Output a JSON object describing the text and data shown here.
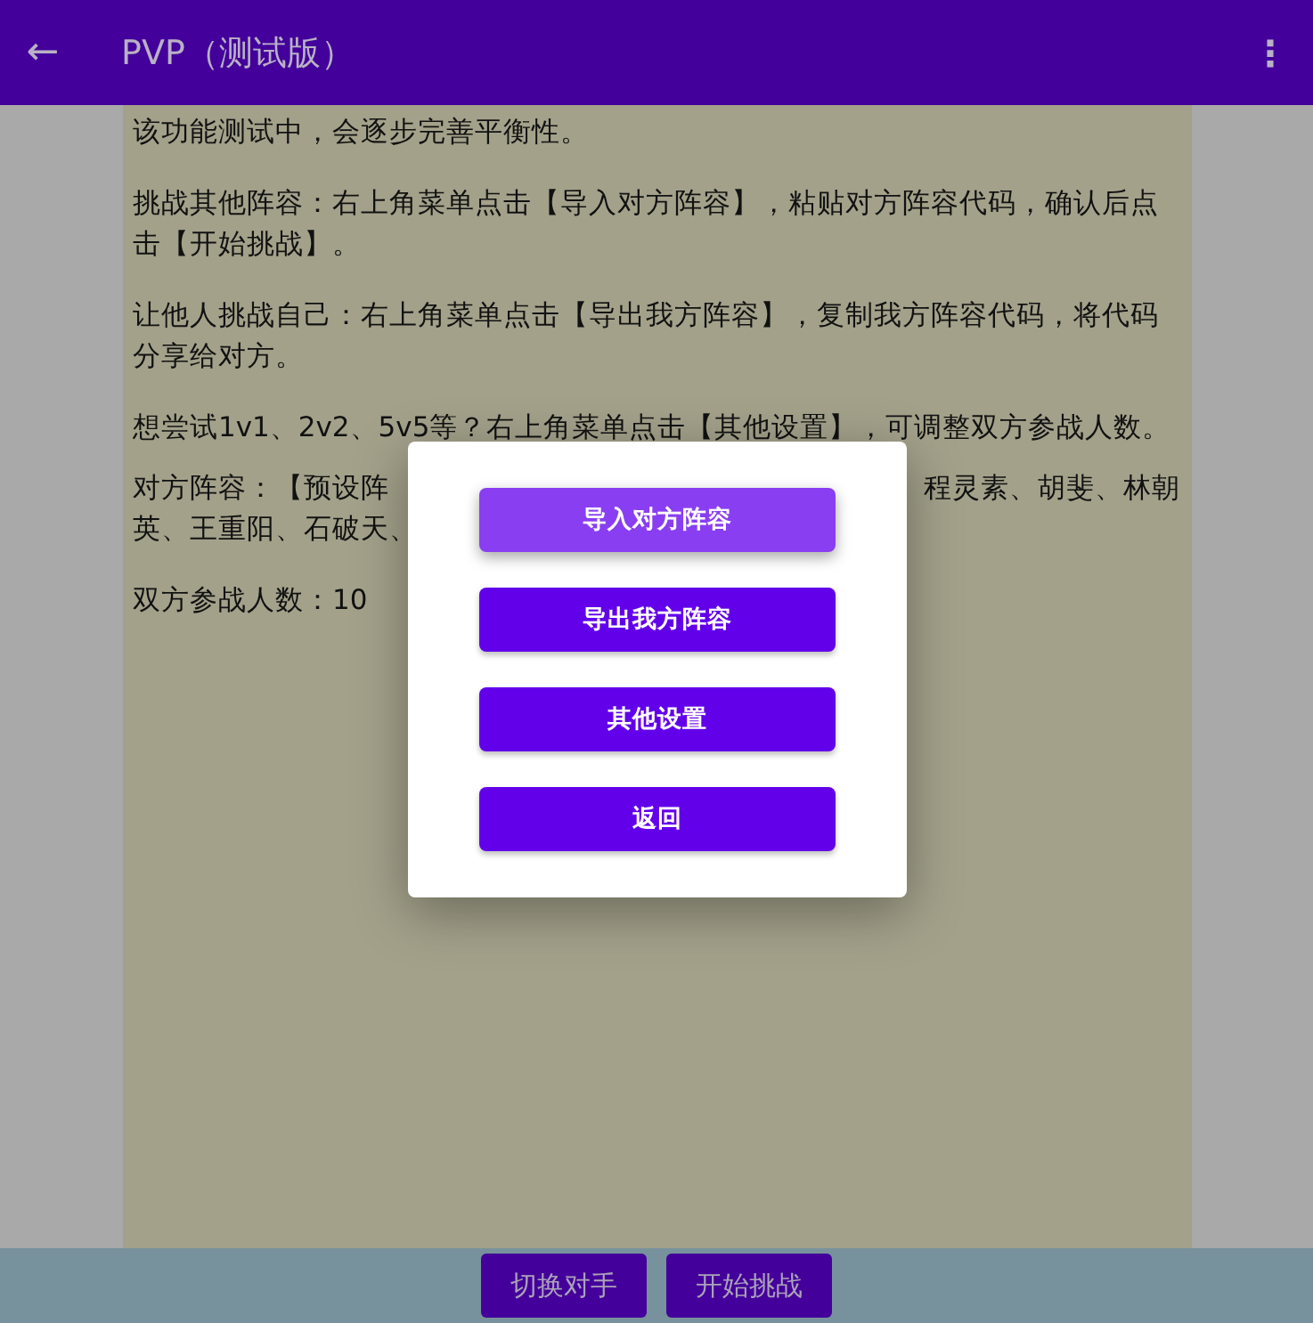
{
  "app_bar": {
    "title": "PVP（测试版）",
    "back_icon": "←",
    "menu_icon": "⋮"
  },
  "content": {
    "paragraphs": [
      {
        "text": "该功能测试中，会逐步完善平衡性。"
      },
      {
        "text": "挑战其他阵容：右上角菜单点击【导入对方阵容】，粘贴对方阵容代码，确认后点击【开始挑战】。"
      },
      {
        "text": "让他人挑战自己：右上角菜单点击【导出我方阵容】，复制我方阵容代码，将代码分享给对方。"
      },
      {
        "text": "想尝试1v1、2v2、5v5等？右上角菜单点击【其他设置】，可调整双方参战人数。"
      }
    ],
    "lineup": {
      "line_1_left": "对方阵容：【预设阵",
      "line_1_right": "程灵素、胡斐、林朝",
      "line_2_left": "英、王重阳、石破天、"
    },
    "count": "双方参战人数：10"
  },
  "dialog": {
    "buttons": [
      {
        "label": "导入对方阵容",
        "focused": true
      },
      {
        "label": "导出我方阵容",
        "focused": false
      },
      {
        "label": "其他设置",
        "focused": false
      },
      {
        "label": "返回",
        "focused": false
      }
    ]
  },
  "bottom_bar": {
    "buttons": [
      "切换对手",
      "开始挑战"
    ]
  }
}
